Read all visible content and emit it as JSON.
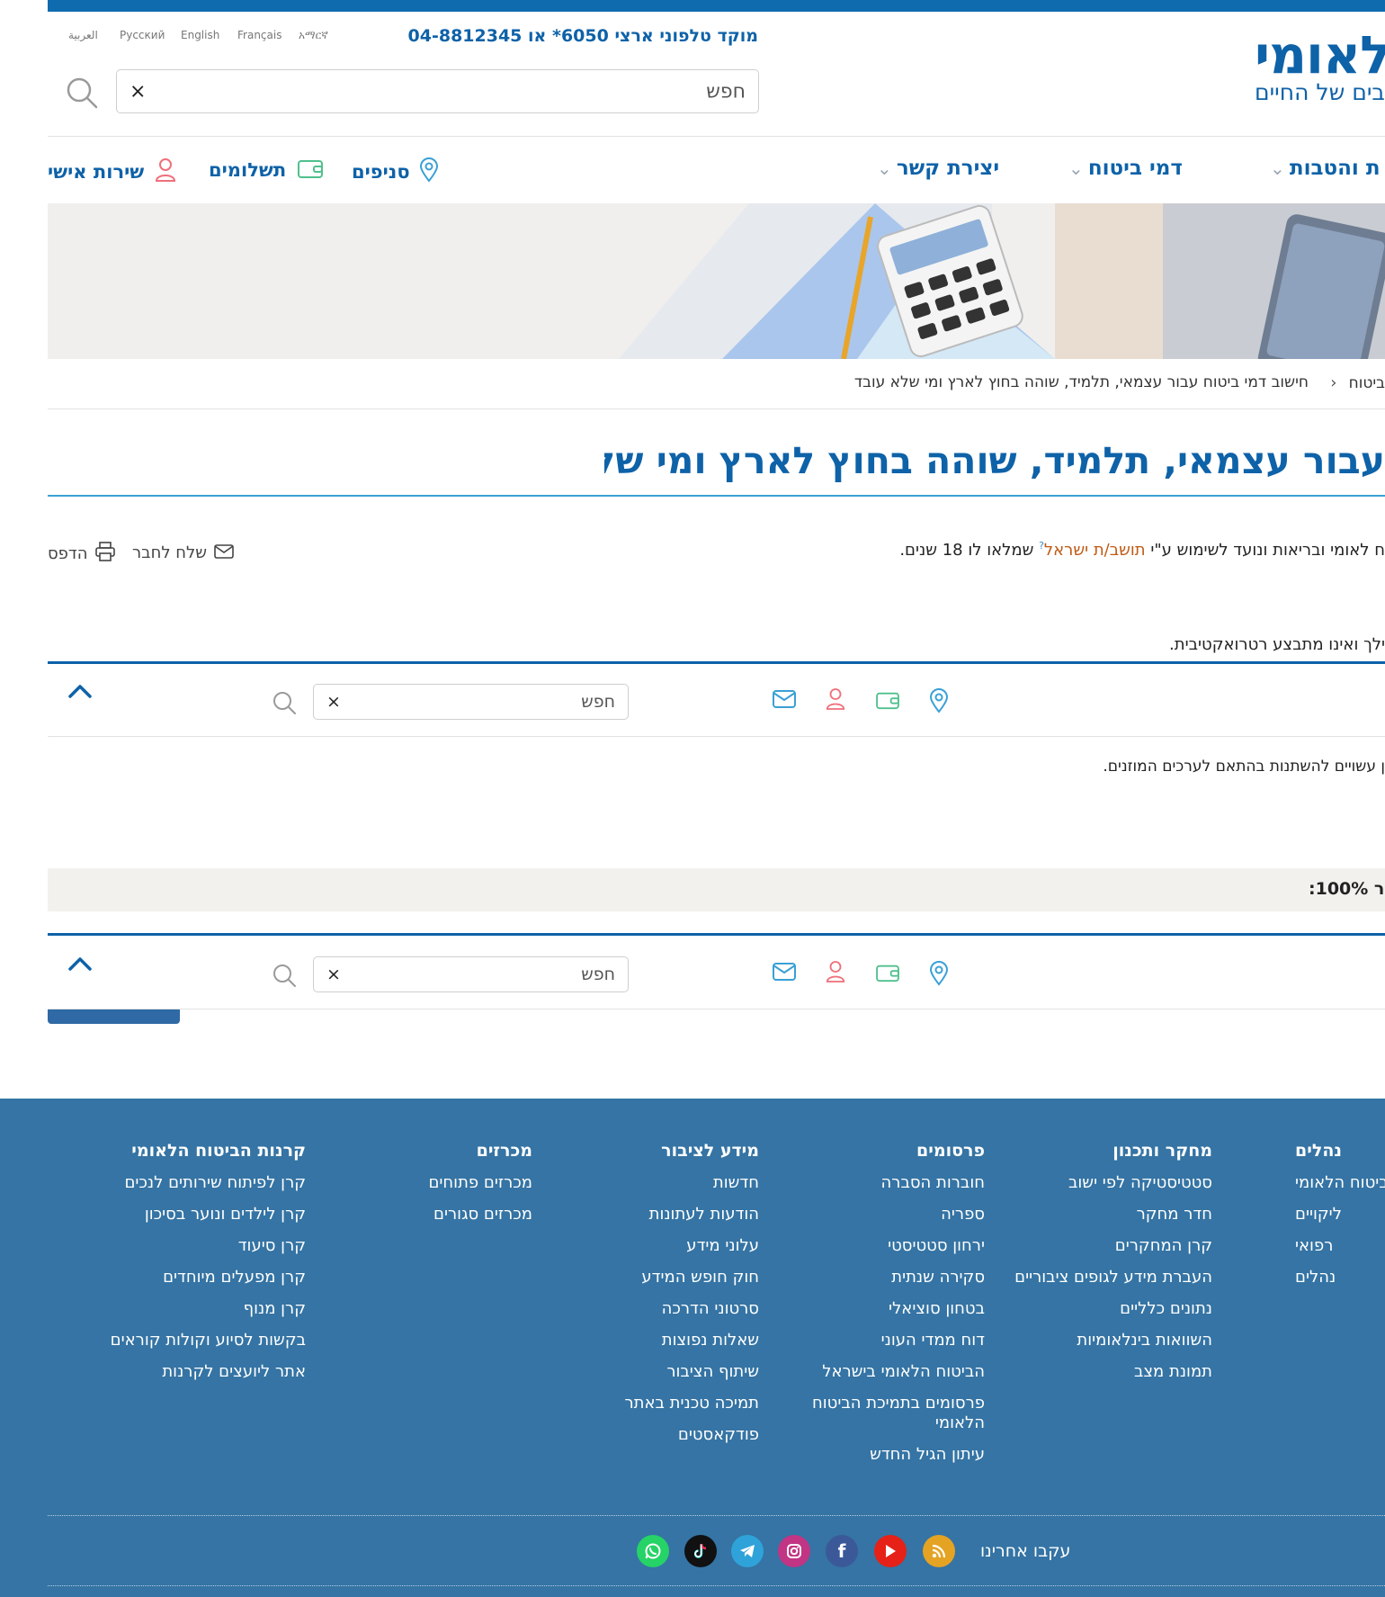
{
  "header": {
    "logo_main": "הלאומי",
    "logo_sub": "בים של החיים",
    "languages": [
      "العربية",
      "Русский",
      "English",
      "Français",
      "አማርኛ"
    ],
    "hotline": "מוקד טלפוני ארצי 6050* או 04-8812345",
    "search_placeholder": "חפש",
    "search_clear": "×"
  },
  "nav": {
    "items": [
      {
        "label": "ת והטבות"
      },
      {
        "label": "דמי ביטוח"
      },
      {
        "label": "יצירת קשר"
      }
    ],
    "quick_links": [
      {
        "label": "סניפים",
        "icon": "location-pin-icon"
      },
      {
        "label": "תשלומים",
        "icon": "wallet-icon"
      },
      {
        "label": "שירות אישי",
        "icon": "user-icon"
      }
    ]
  },
  "breadcrumb": {
    "parent": "ביטוח",
    "current": "חישוב דמי ביטוח עבור עצמאי, תלמיד, שוהה בחוץ לארץ ומי שלא עובד"
  },
  "page_title": "עבור עצמאי, תלמיד, שוהה בחוץ לארץ ומי שלא עובד",
  "content": {
    "intro_before_link": "ח לאומי ובריאות ונועד לשימוש ע\"י",
    "intro_link": "תושב/ת ישראל",
    "intro_after_link": "שמלאו לו 18 שנים.",
    "actions": {
      "send": "שלח לחבר",
      "print": "הדפס"
    },
    "line2": "ילך ואינו מתבצע רטרואקטיבית.",
    "line3": "ן עשויים להשתנות בהתאם לערכים המוזנים.",
    "percent": ":100% ר"
  },
  "sticky_bar": {
    "search_placeholder": "חפש",
    "search_clear": "×",
    "icons": [
      "location-pin-icon",
      "wallet-icon",
      "user-icon",
      "envelope-icon"
    ]
  },
  "footer": {
    "columns": [
      {
        "title": "קרנות הביטוח הלאומי",
        "links": [
          "קרן לפיתוח שירותים לנכים",
          "קרן לילדים ונוער בסיכון",
          "קרן סיעוד",
          "קרן מפעלים מיוחדים",
          "קרן מנוף",
          "בקשות לסיוע וקולות קוראים",
          "אתר ליועצים לקרנות"
        ]
      },
      {
        "title": "מכרזים",
        "links": [
          "מכרזים פתוחים",
          "מכרזים סגורים"
        ]
      },
      {
        "title": "מידע לציבור",
        "links": [
          "חדשות",
          "הודעות לעתונות",
          "עלוני מידע",
          "חוק חופש המידע",
          "סרטוני הדרכה",
          "שאלות נפוצות",
          "שיתוף הציבור",
          "תמיכה טכנית באתר",
          "פודקאסטים"
        ]
      },
      {
        "title": "פרסומים",
        "links": [
          "חוברות הסברה",
          "ספריה",
          "ירחון סטטיסטי",
          "סקירה שנתית",
          "בטחון סוציאלי",
          "דוח ממדי העוני",
          "הביטוח הלאומי בישראל",
          "פרסומים בתמיכת הביטוח הלאומי",
          "עיתון הגיל החדש"
        ]
      },
      {
        "title": "מחקר ותכנון",
        "links": [
          "סטטיסטיקה לפי ישוב",
          "חדר מחקר",
          "קרן המחקרים",
          "העברת מידע לגופים ציבוריים",
          "נתונים כלליים",
          "השוואות בינלאומיות",
          "תמונת מצב"
        ]
      },
      {
        "title": "נהלים",
        "links": [
          "ביטוח הלאומי",
          "ליקויים",
          "רפואי",
          "נהלים"
        ]
      }
    ],
    "follow_label": "עקבו אחרינו",
    "social": [
      {
        "name": "rss",
        "color": "#e5a323"
      },
      {
        "name": "youtube",
        "color": "#e62117"
      },
      {
        "name": "facebook",
        "color": "#3b5998"
      },
      {
        "name": "instagram",
        "color": "#c13584"
      },
      {
        "name": "telegram",
        "color": "#2fa3d9"
      },
      {
        "name": "tiktok",
        "color": "#111111"
      },
      {
        "name": "whatsapp",
        "color": "#25d366"
      }
    ]
  }
}
